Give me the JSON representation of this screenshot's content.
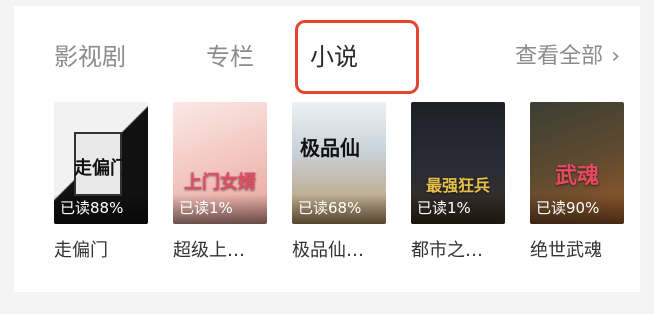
{
  "tabs": [
    {
      "label": "影视剧"
    },
    {
      "label": "专栏"
    },
    {
      "label": "小说",
      "active": true
    }
  ],
  "see_all": {
    "label": "查看全部",
    "icon": "chevron-right-icon"
  },
  "accent_color": "#e5452f",
  "books": [
    {
      "title": "走偏门",
      "progress": "已读88%",
      "cover_text": "走偏门"
    },
    {
      "title": "超级上…",
      "progress": "已读1%",
      "cover_text": "上门女婿"
    },
    {
      "title": "极品仙…",
      "progress": "已读68%",
      "cover_text": "极品仙"
    },
    {
      "title": "都市之…",
      "progress": "已读1%",
      "cover_text": "最强狂兵"
    },
    {
      "title": "绝世武魂",
      "progress": "已读90%",
      "cover_text": "武魂"
    }
  ]
}
